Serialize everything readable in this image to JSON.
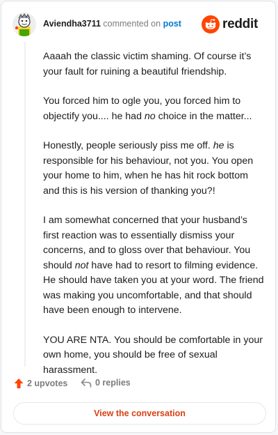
{
  "header": {
    "author": "Aviendha3711",
    "commented_on": "commented on",
    "post_link": "post",
    "brand_wordmark": "reddit"
  },
  "comment": {
    "paragraphs": [
      [
        "Aaaah the classic victim shaming. Of course it’s your fault for ruining a beautiful friendship."
      ],
      [
        "You forced him to ogle you, you forced him to objectify you.... he had ",
        "no",
        " choice in the matter..."
      ],
      [
        "Honestly, people seriously piss me off. ",
        "he",
        " is responsible for his behaviour, not you. You open your home to him, when he has hit rock bottom and this is his version of thanking you?!"
      ],
      [
        "I am somewhat concerned that your husband’s first reaction was to essentially dismiss your concerns, and to gloss over that behaviour. You should ",
        "not",
        " have had to resort to filming evidence. He should have taken you at your word. The friend was making you uncomfortable, and that should have been enough to intervene."
      ],
      [
        "YOU ARE NTA. You should be comfortable in your own home, you should be free of sexual harassment."
      ]
    ]
  },
  "actions": {
    "upvotes_label": "2 upvotes",
    "replies_label": "0 replies"
  },
  "view_button_label": "View the conversation",
  "colors": {
    "reddit_orange": "#ff4500",
    "link_blue": "#0079d3",
    "button_text": "#d94014",
    "muted": "#7c7c7c"
  },
  "icons": {
    "upvote": "upvote-arrow-icon",
    "reply": "reply-arrow-icon",
    "brand": "reddit-snoo-icon",
    "avatar": "user-avatar"
  }
}
